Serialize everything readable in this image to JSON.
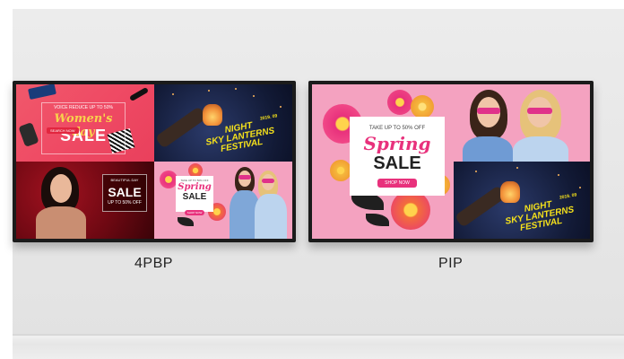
{
  "displays": [
    {
      "caption": "4PBP",
      "tiles": {
        "womens_day": {
          "top_text": "VOICE REDUCE UP TO 50%",
          "headline": "Women's day",
          "sale": "SALE",
          "button": "SEARCH NOW"
        },
        "lanterns": {
          "year": "2019. 09",
          "line1": "NIGHT",
          "line2": "SKY LANTERNS",
          "line3": "FESTIVAL"
        },
        "beauty": {
          "top_text": "BEAUTIFUL DAY",
          "sale": "SALE",
          "sub": "UP TO 50% OFF"
        },
        "spring": {
          "top_text": "TAKE UP TO 50% OFF",
          "headline": "Spring",
          "sale": "SALE",
          "button": "SHOP NOW"
        }
      }
    },
    {
      "caption": "PIP",
      "main": {
        "top_text": "TAKE UP TO 50% OFF",
        "headline": "Spring",
        "sale": "SALE",
        "button": "SHOP NOW"
      },
      "inset": {
        "year": "2019. 09",
        "line1": "NIGHT",
        "line2": "SKY LANTERNS",
        "line3": "FESTIVAL"
      }
    }
  ],
  "colors": {
    "accent_pink": "#e8317c",
    "lantern_yellow": "#f5e11b",
    "bezel": "#1b1b1b"
  }
}
